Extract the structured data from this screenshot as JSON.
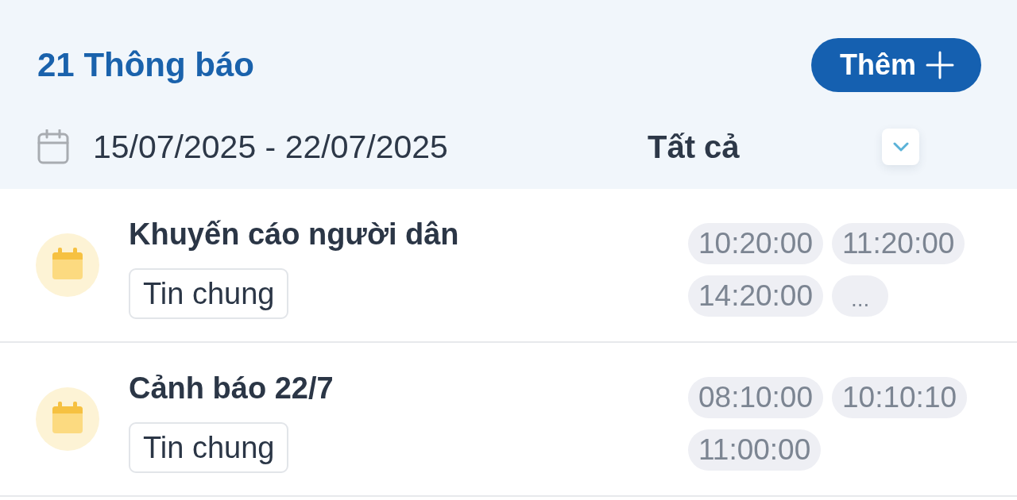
{
  "header": {
    "title": "21 Thông báo",
    "add_button": {
      "label": "Thêm"
    }
  },
  "filter": {
    "date_range": "15/07/2025 - 22/07/2025",
    "category": "Tất cả"
  },
  "notifications": [
    {
      "title": "Khuyến cáo người dân",
      "tag": "Tin chung",
      "times": [
        "10:20:00",
        "11:20:00",
        "14:20:00"
      ],
      "more": "..."
    },
    {
      "title": "Cảnh báo 22/7",
      "tag": "Tin chung",
      "times": [
        "08:10:00",
        "10:10:10",
        "11:00:00"
      ]
    }
  ]
}
